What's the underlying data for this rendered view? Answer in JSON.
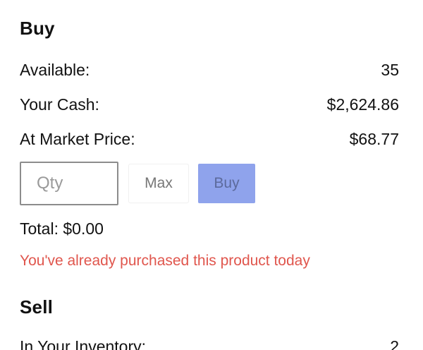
{
  "buy": {
    "title": "Buy",
    "available_label": "Available:",
    "available_value": "35",
    "cash_label": "Your Cash:",
    "cash_value": "$2,624.86",
    "market_price_label": "At Market Price:",
    "market_price_value": "$68.77",
    "qty_placeholder": "Qty",
    "max_label": "Max",
    "buy_label": "Buy",
    "total_text": "Total: $0.00",
    "error_message": "You've already purchased this product today"
  },
  "sell": {
    "title": "Sell",
    "inventory_label": "In Your Inventory:",
    "inventory_value": "2"
  },
  "colors": {
    "buy_button_bg": "#8fa3ec",
    "error_text": "#e0564d"
  }
}
